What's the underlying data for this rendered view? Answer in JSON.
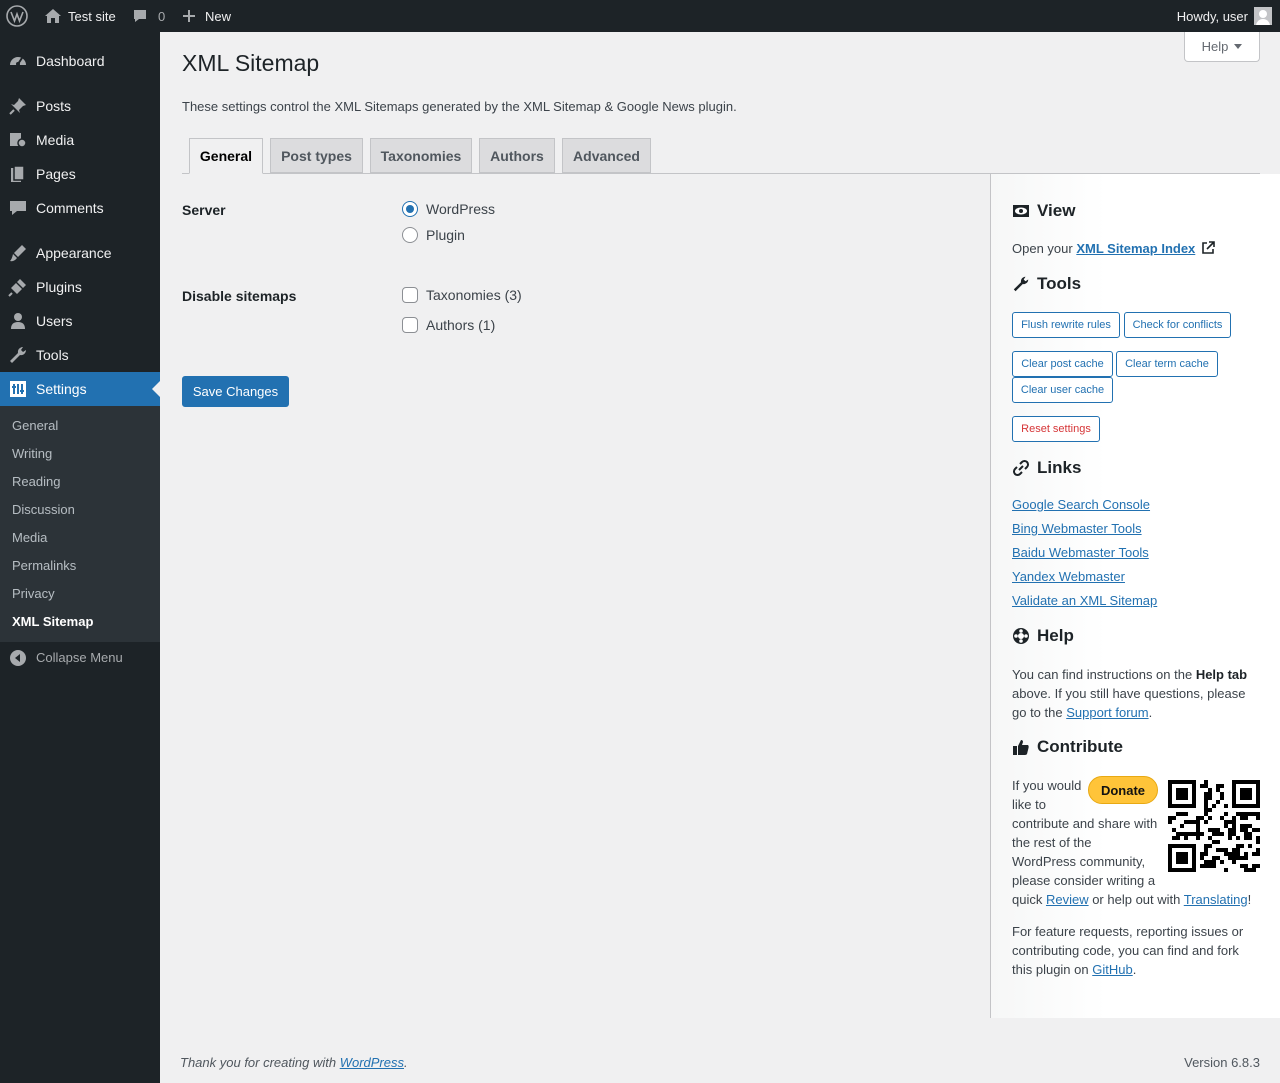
{
  "adminbar": {
    "site_name": "Test site",
    "comments_count": "0",
    "new_label": "New",
    "greeting": "Howdy, user"
  },
  "sidebar": {
    "items": [
      {
        "label": "Dashboard",
        "icon": "dashboard-icon"
      },
      {
        "label": "Posts",
        "icon": "pushpin-icon"
      },
      {
        "label": "Media",
        "icon": "media-icon"
      },
      {
        "label": "Pages",
        "icon": "pages-icon"
      },
      {
        "label": "Comments",
        "icon": "comment-icon"
      },
      {
        "label": "Appearance",
        "icon": "paintbrush-icon"
      },
      {
        "label": "Plugins",
        "icon": "plugin-icon"
      },
      {
        "label": "Users",
        "icon": "user-icon"
      },
      {
        "label": "Tools",
        "icon": "wrench-icon"
      },
      {
        "label": "Settings",
        "icon": "settings-icon"
      }
    ],
    "submenu": [
      "General",
      "Writing",
      "Reading",
      "Discussion",
      "Media",
      "Permalinks",
      "Privacy",
      "XML Sitemap"
    ],
    "collapse_label": "Collapse Menu"
  },
  "help_tab": {
    "label": "Help"
  },
  "page": {
    "title": "XML Sitemap",
    "intro": "These settings control the XML Sitemaps generated by the XML Sitemap & Google News plugin."
  },
  "tabs": [
    "General",
    "Post types",
    "Taxonomies",
    "Authors",
    "Advanced"
  ],
  "form": {
    "server_label": "Server",
    "server_options": [
      "WordPress",
      "Plugin"
    ],
    "server_selected": "WordPress",
    "disable_label": "Disable sitemaps",
    "disable_options": [
      "Taxonomies (3)",
      "Authors (1)"
    ],
    "save_label": "Save Changes"
  },
  "side": {
    "view": {
      "title": "View",
      "text_before": "Open your ",
      "link": "XML Sitemap Index"
    },
    "tools": {
      "title": "Tools",
      "buttons": [
        "Flush rewrite rules",
        "Check for conflicts",
        "Clear post cache",
        "Clear term cache",
        "Clear user cache",
        "Reset settings"
      ]
    },
    "links": {
      "title": "Links",
      "items": [
        "Google Search Console",
        "Bing Webmaster Tools",
        "Baidu Webmaster Tools",
        "Yandex Webmaster",
        "Validate an XML Sitemap"
      ]
    },
    "help": {
      "title": "Help",
      "t1": "You can find instructions on the ",
      "bold": "Help tab",
      "t2": " above. If you still have questions, please go to the ",
      "link": "Support forum",
      "t3": "."
    },
    "contribute": {
      "title": "Contribute",
      "donate": "Donate",
      "p1_lines": [
        "If you would",
        "like to",
        "contribute and share with",
        "the rest of the",
        "WordPress community,",
        "please consider writing a"
      ],
      "p1_quick": "quick ",
      "review": "Review",
      "p1_mid": " or help out with ",
      "translating": "Translating",
      "p1_end": "!",
      "p2_lines": [
        "For feature requests, reporting issues or",
        "contributing code, you can find and fork"
      ],
      "p2_last": "this plugin on ",
      "github": "GitHub",
      "p2_end": "."
    }
  },
  "footer": {
    "thanks": "Thank you for creating with ",
    "wp_link": "WordPress",
    "thanks_end": ".",
    "version": "Version 6.8.3"
  },
  "colors": {
    "accent": "#2271b1",
    "adminbar": "#1d2327",
    "donate": "#ffc439",
    "danger": "#d63638"
  }
}
